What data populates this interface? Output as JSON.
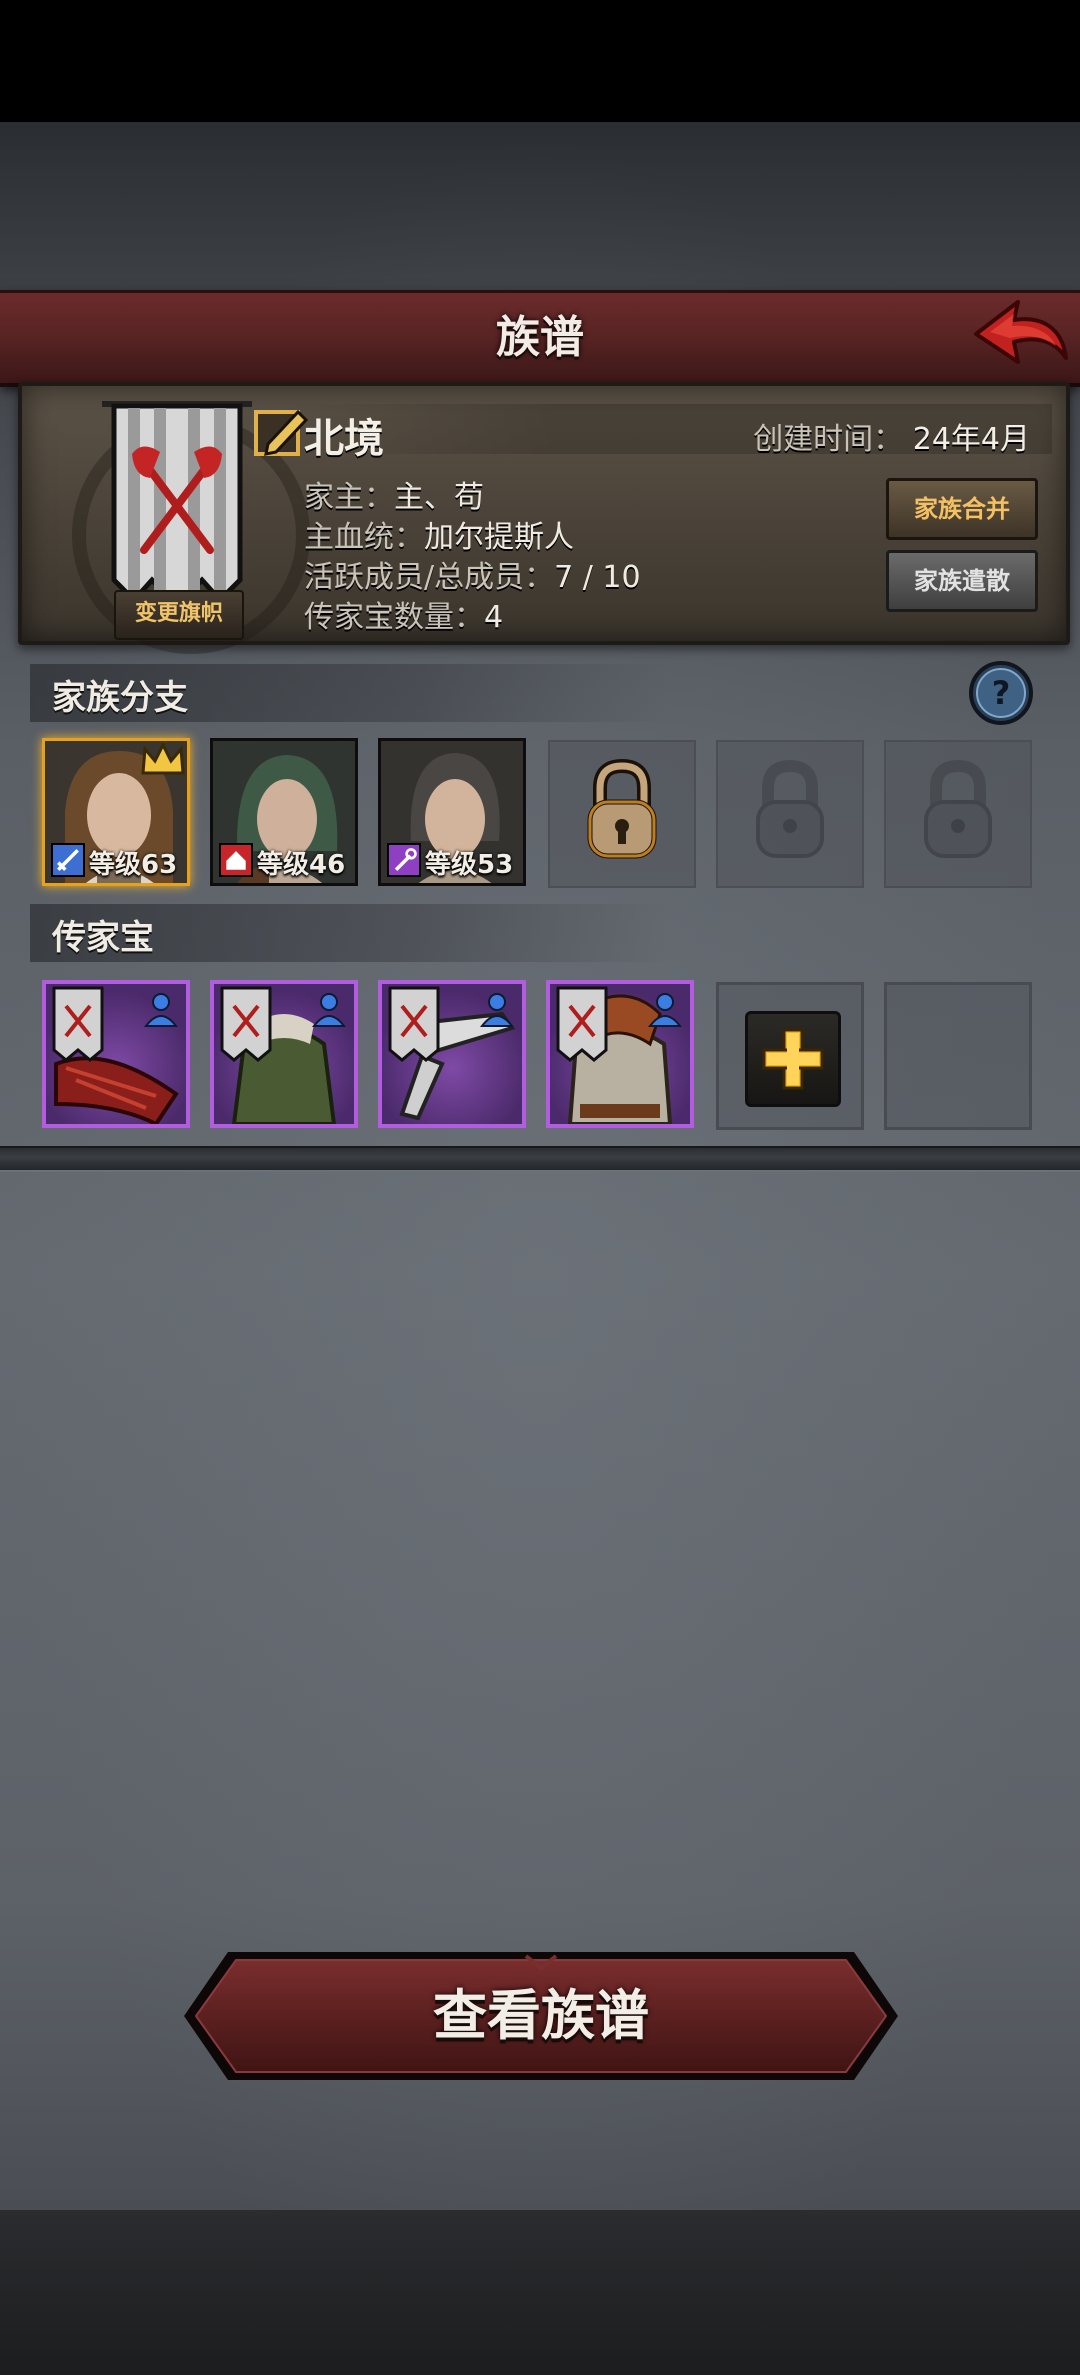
{
  "header": {
    "title": "族谱"
  },
  "family": {
    "change_flag_label": "变更旗帜",
    "name": "北境",
    "created_label": "创建时间：",
    "created_value": "24年4月",
    "head_label": "家主：",
    "head_value": "主、苟",
    "bloodline_label": "主血统：",
    "bloodline_value": "加尔提斯人",
    "members_label": "活跃成员/总成员：",
    "members_value": "7 / 10",
    "heirloom_count_label": "传家宝数量：",
    "heirloom_count_value": "4",
    "merge_label": "家族合并",
    "disband_label": "家族遣散"
  },
  "branches": {
    "title": "家族分支",
    "members": [
      {
        "level": "等级63",
        "role_icon": "sword-icon",
        "role_color": "#3c6fd1",
        "leader": true
      },
      {
        "level": "等级46",
        "role_icon": "house-icon",
        "role_color": "#c8252a",
        "leader": false
      },
      {
        "level": "等级53",
        "role_icon": "staff-icon",
        "role_color": "#8f3fc2",
        "leader": false
      }
    ],
    "locked_slots": 3
  },
  "heirlooms": {
    "title": "传家宝",
    "items": [
      {
        "name": "red-wing-heirloom"
      },
      {
        "name": "green-cloak-heirloom"
      },
      {
        "name": "silver-blade-heirloom"
      },
      {
        "name": "fur-armor-heirloom"
      }
    ]
  },
  "footer": {
    "view_label": "查看族谱"
  },
  "colors": {
    "accent_red": "#5a2424",
    "gold": "#e6a21d",
    "rarity_purple": "#b25ce0"
  }
}
